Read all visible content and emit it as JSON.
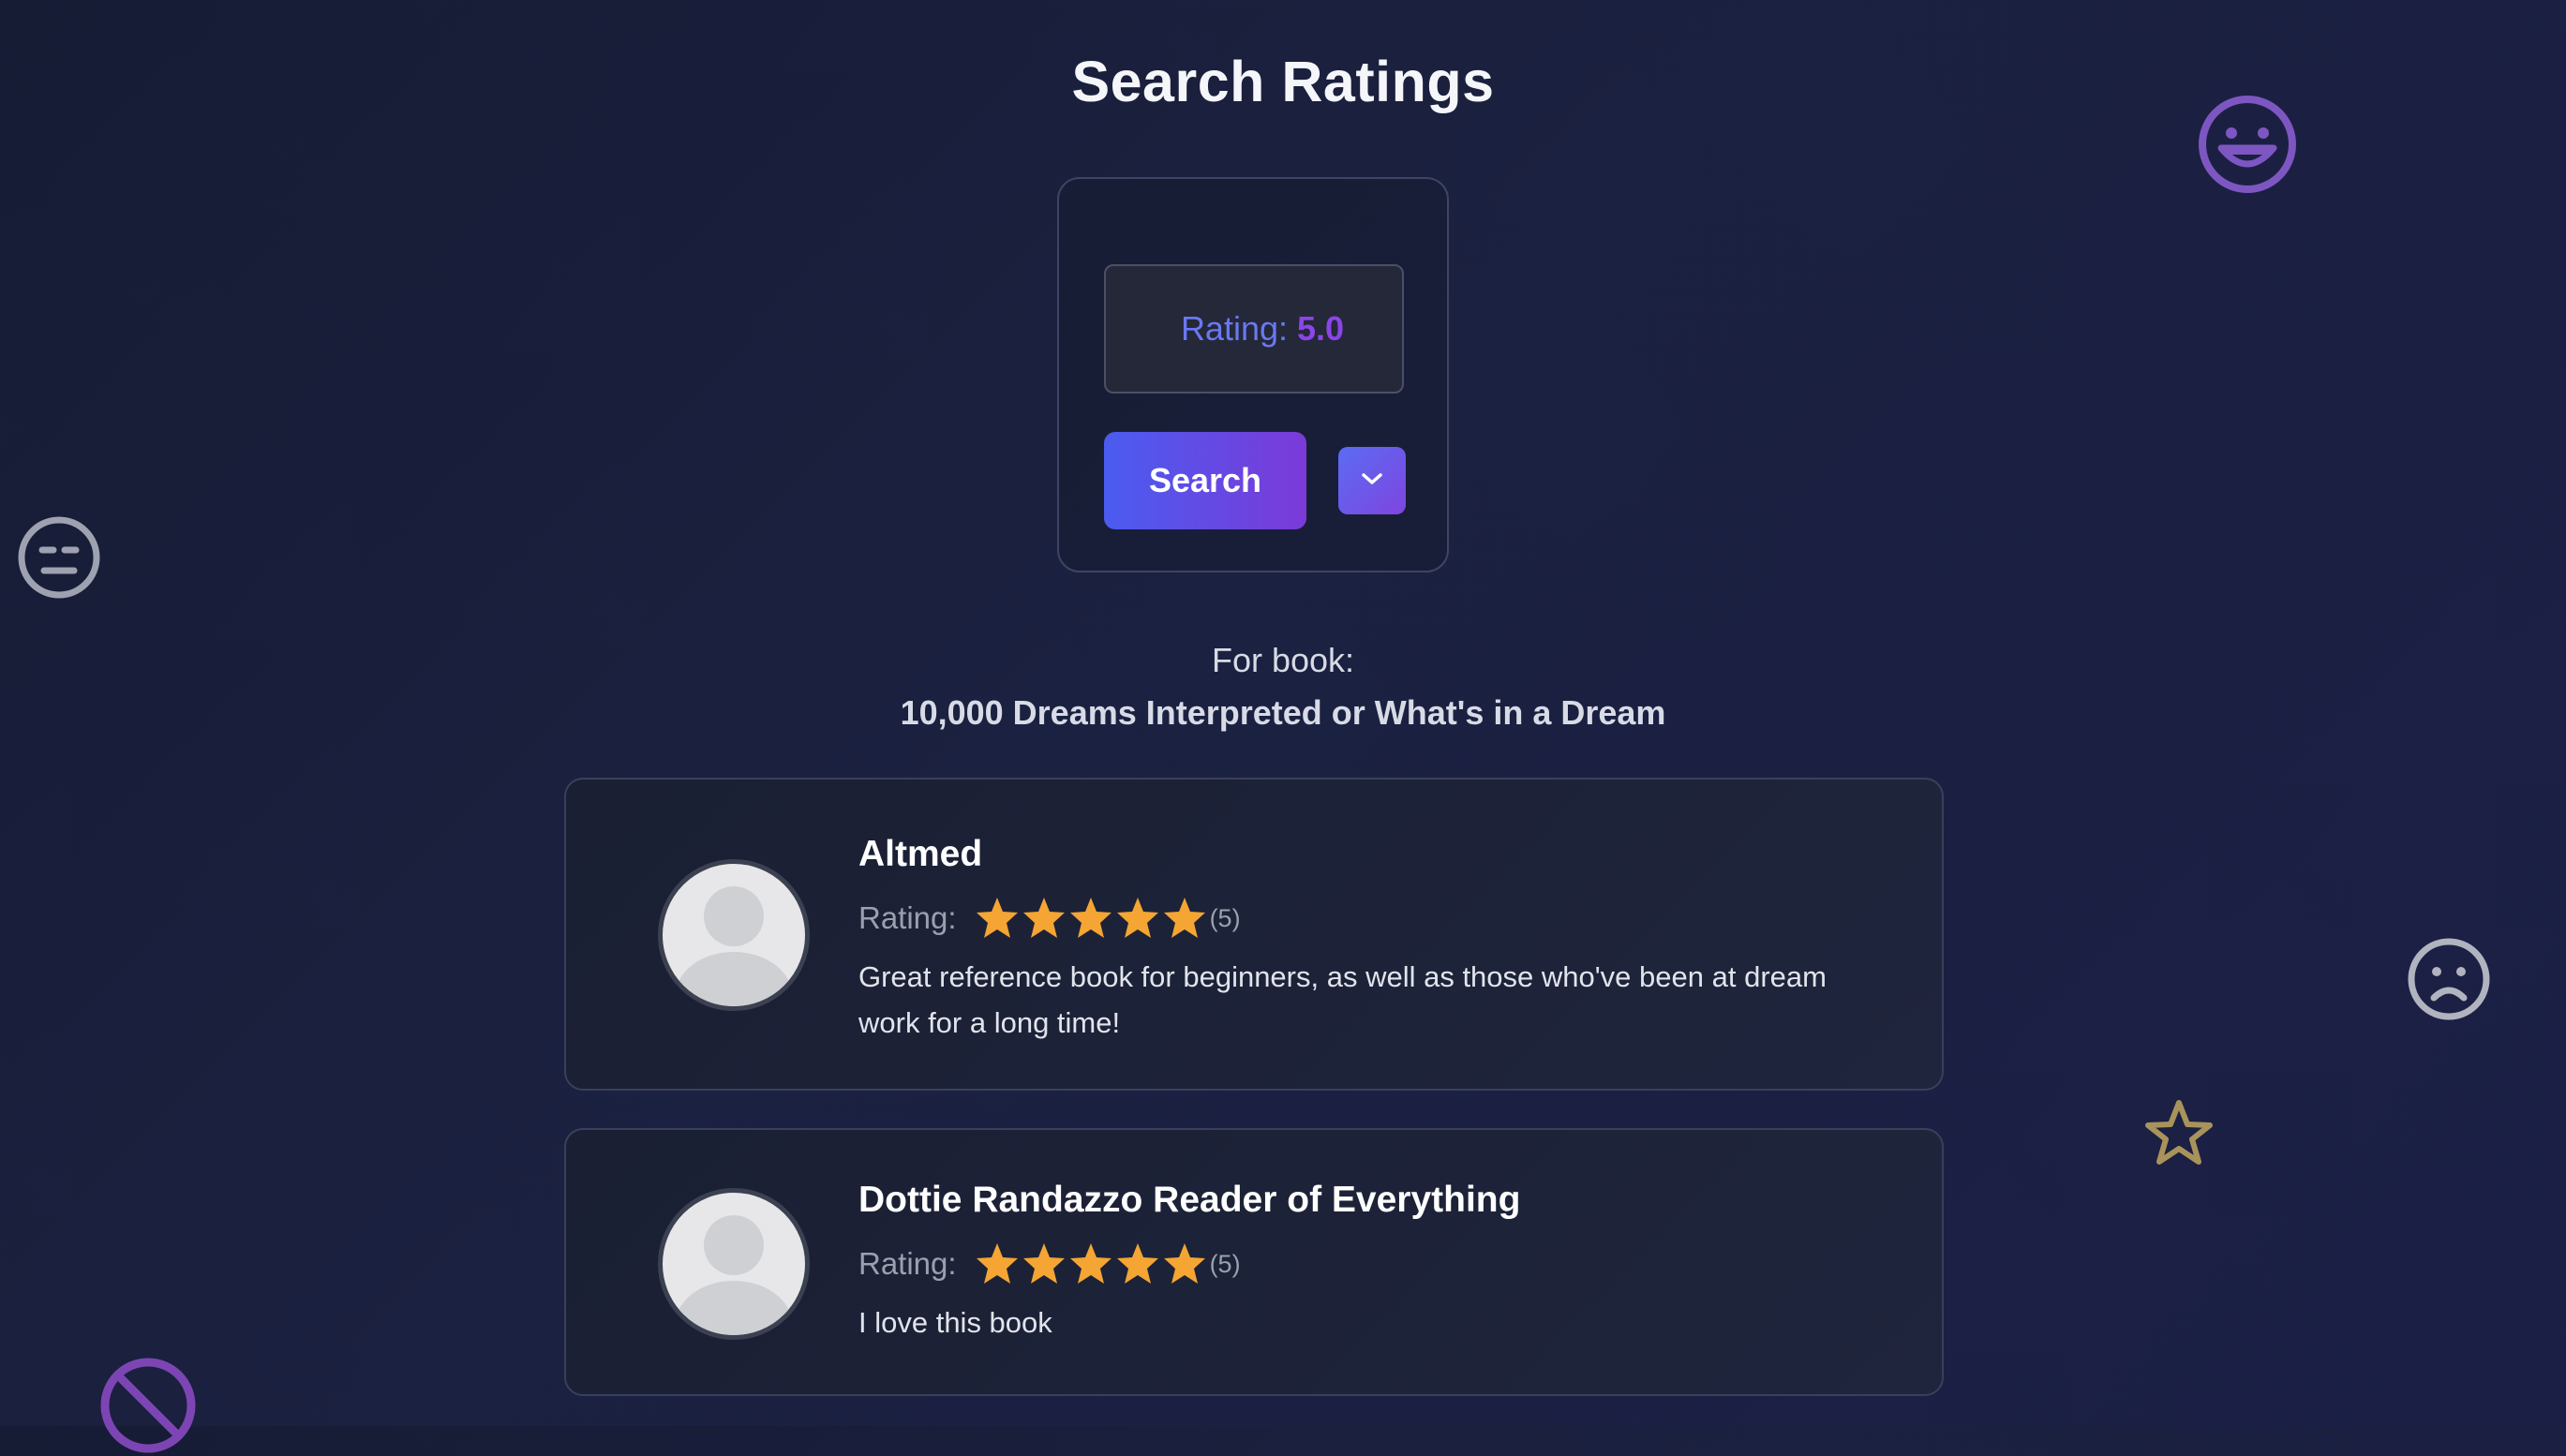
{
  "page": {
    "title": "Search Ratings"
  },
  "search": {
    "rating_label": "Rating:",
    "rating_value": "5.0",
    "search_button_label": "Search",
    "dropdown_icon": "chevron-down-icon"
  },
  "book": {
    "for_label": "For book:",
    "title": "10,000 Dreams Interpreted or What's in a Dream"
  },
  "reviews": [
    {
      "name": "Altmed",
      "rating_label": "Rating:",
      "stars": 5,
      "count": "(5)",
      "text": "Great reference book for beginners, as well as those who've been at dream work for a long time!"
    },
    {
      "name": "Dottie Randazzo Reader of Everything",
      "rating_label": "Rating:",
      "stars": 5,
      "count": "(5)",
      "text": "I love this book"
    }
  ],
  "colors": {
    "accent_blue": "#4a5cf0",
    "accent_purple": "#7b3ad8",
    "star": "#f4a533",
    "background": "#181d36"
  },
  "decorations": [
    "grin-face-icon",
    "neutral-face-icon",
    "sad-face-icon",
    "star-outline-icon",
    "ban-icon"
  ]
}
